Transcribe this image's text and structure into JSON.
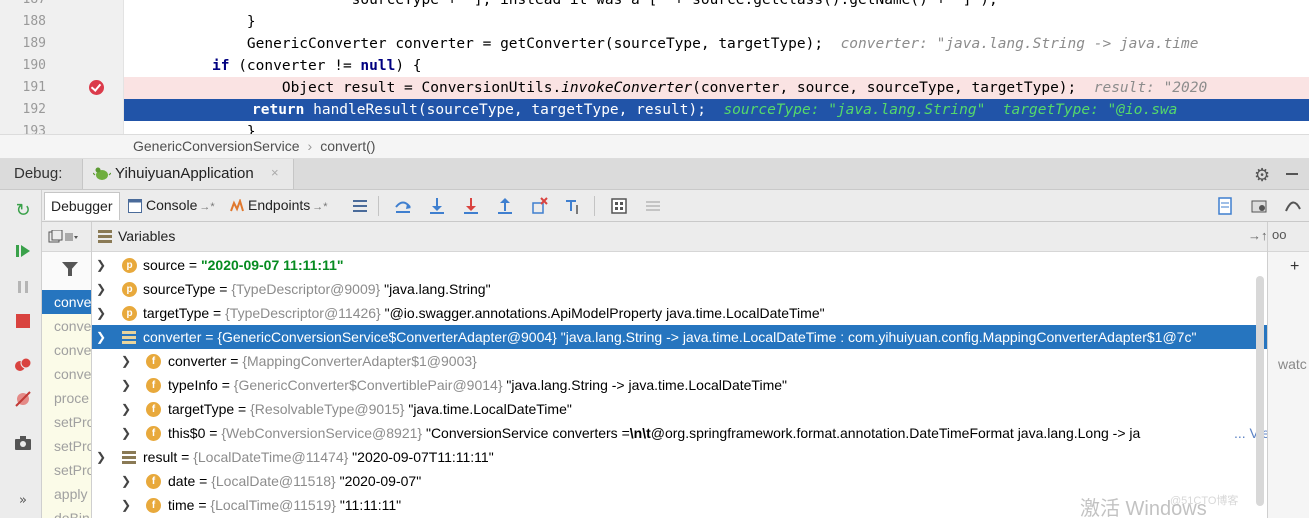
{
  "editor": {
    "line_numbers": [
      "187",
      "188",
      "189",
      "190",
      "191",
      "192",
      "193"
    ],
    "line187": {
      "code": "                sourceType + \"], instead it was a [\" + source.getClass().getName() + \"]\");"
    },
    "line188": {
      "code": "    }"
    },
    "line189": {
      "code": "    GenericConverter converter = getConverter(sourceType, targetType);",
      "hint": "converter: \"java.lang.String -> java.time"
    },
    "line190": {
      "kw": "if",
      "code": " (converter != ",
      "kw2": "null",
      "code2": ") {"
    },
    "line191": {
      "pre": "        Object result = ConversionUtils.",
      "italic": "invokeConverter",
      "post": "(converter, source, sourceType, targetType);",
      "hint": "result: \"2020"
    },
    "line192": {
      "kw": "return",
      "code": " handleResult(sourceType, targetType, result);",
      "hint": "sourceType: \"java.lang.String\"  targetType: \"@io.swa"
    },
    "line193": {
      "code": "    }"
    }
  },
  "breadcrumb": {
    "class_name": "GenericConversionService",
    "method_name": "convert()"
  },
  "debug": {
    "title": "Debug:",
    "session": "YihuiyuanApplication",
    "session_close": "×"
  },
  "tabs": {
    "debugger": "Debugger",
    "console": "Console",
    "console_arrow": "→*",
    "endpoints": "Endpoints",
    "endpoints_arrow": "→*"
  },
  "frames": [
    "conve",
    "conve",
    "conve",
    "conve",
    "proce",
    "setPro",
    "setPro",
    "setPro",
    "apply",
    "doBin"
  ],
  "variables": {
    "title": "Variables",
    "pin": "→↑",
    "rows": [
      {
        "badge": "p",
        "name": "source",
        "eq": " = ",
        "value": "\"2020-09-07 11:11:11\""
      },
      {
        "badge": "p",
        "name": "sourceType",
        "eq": " = ",
        "type": "{TypeDescriptor@9009}",
        "value": " \"java.lang.String\""
      },
      {
        "badge": "p",
        "name": "targetType",
        "eq": " = ",
        "type": "{TypeDescriptor@11426}",
        "value": " \"@io.swagger.annotations.ApiModelProperty java.time.LocalDateTime\""
      },
      {
        "name": "converter",
        "eq": " = ",
        "type": "{GenericConversionService$ConverterAdapter@9004}",
        "value": " \"java.lang.String -> java.time.LocalDateTime : com.yihuiyuan.config.MappingConverterAdapter$1@7c\""
      },
      {
        "badge": "f",
        "name": "converter",
        "eq": " = ",
        "type": "{MappingConverterAdapter$1@9003}"
      },
      {
        "badge": "f",
        "name": "typeInfo",
        "eq": " = ",
        "type": "{GenericConverter$ConvertiblePair@9014}",
        "value": " \"java.lang.String -> java.time.LocalDateTime\""
      },
      {
        "badge": "f",
        "name": "targetType",
        "eq": " = ",
        "type": "{ResolvableType@9015}",
        "value": " \"java.time.LocalDateTime\""
      },
      {
        "badge": "f",
        "name": "this$0",
        "eq": " = ",
        "type": "{WebConversionService@8921}",
        "value_pre": " \"ConversionService converters =",
        "value_bold": "\\n\\t",
        "value_post": "@org.springframework.format.annotation.DateTimeFormat java.lang.Long -> ja",
        "link": "... View"
      },
      {
        "name": "result",
        "eq": " = ",
        "type": "{LocalDateTime@11474}",
        "value": " \"2020-09-07T11:11:11\""
      },
      {
        "badge": "f",
        "name": "date",
        "eq": " = ",
        "type": "{LocalDate@11518}",
        "value": " \"2020-09-07\""
      },
      {
        "badge": "f",
        "name": "time",
        "eq": " = ",
        "type": "{LocalTime@11519}",
        "value": " \"11:11:11\""
      }
    ]
  },
  "watches": {
    "glasses": "oo",
    "plus": "+",
    "hint": "watc"
  },
  "watermark": {
    "text": "激活 Windows",
    "sub": "@51CTO博客"
  },
  "colors": {
    "selection": "#2675bf",
    "exec_line": "#2154a8",
    "breakpoint_line": "#fae3e3",
    "string_green": "#068b20",
    "hint_green": "#55d96a"
  }
}
